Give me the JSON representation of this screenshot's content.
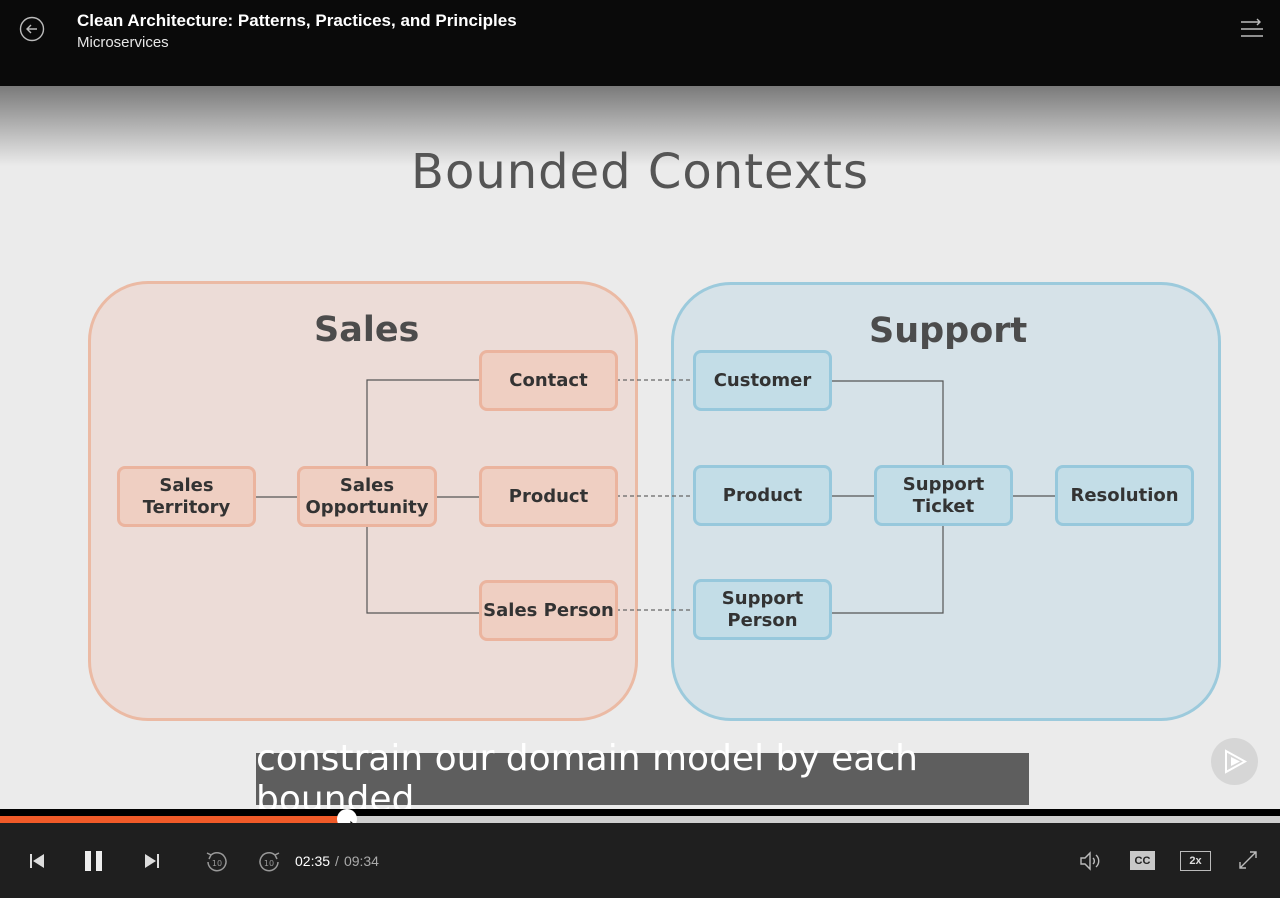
{
  "header": {
    "course_title": "Clean Architecture: Patterns, Practices, and Principles",
    "module_title": "Microservices"
  },
  "slide": {
    "title": "Bounded Contexts",
    "sales": {
      "label": "Sales",
      "boxes": [
        "Sales Territory",
        "Sales Opportunity",
        "Contact",
        "Product",
        "Sales Person"
      ]
    },
    "support": {
      "label": "Support",
      "boxes": [
        "Customer",
        "Product",
        "Support Ticket",
        "Resolution",
        "Support Person"
      ]
    }
  },
  "caption": "constrain our domain model by each bounded",
  "player": {
    "current_time": "02:35",
    "separator": "/",
    "duration": "09:34",
    "progress_percent": 27.1,
    "cc_label": "CC",
    "speed_label": "2x",
    "skip_back_label": "10",
    "skip_forward_label": "10"
  },
  "colors": {
    "accent": "#f05a28",
    "sales_fill": "#ecdcd7",
    "support_fill": "#d6e2e8"
  }
}
